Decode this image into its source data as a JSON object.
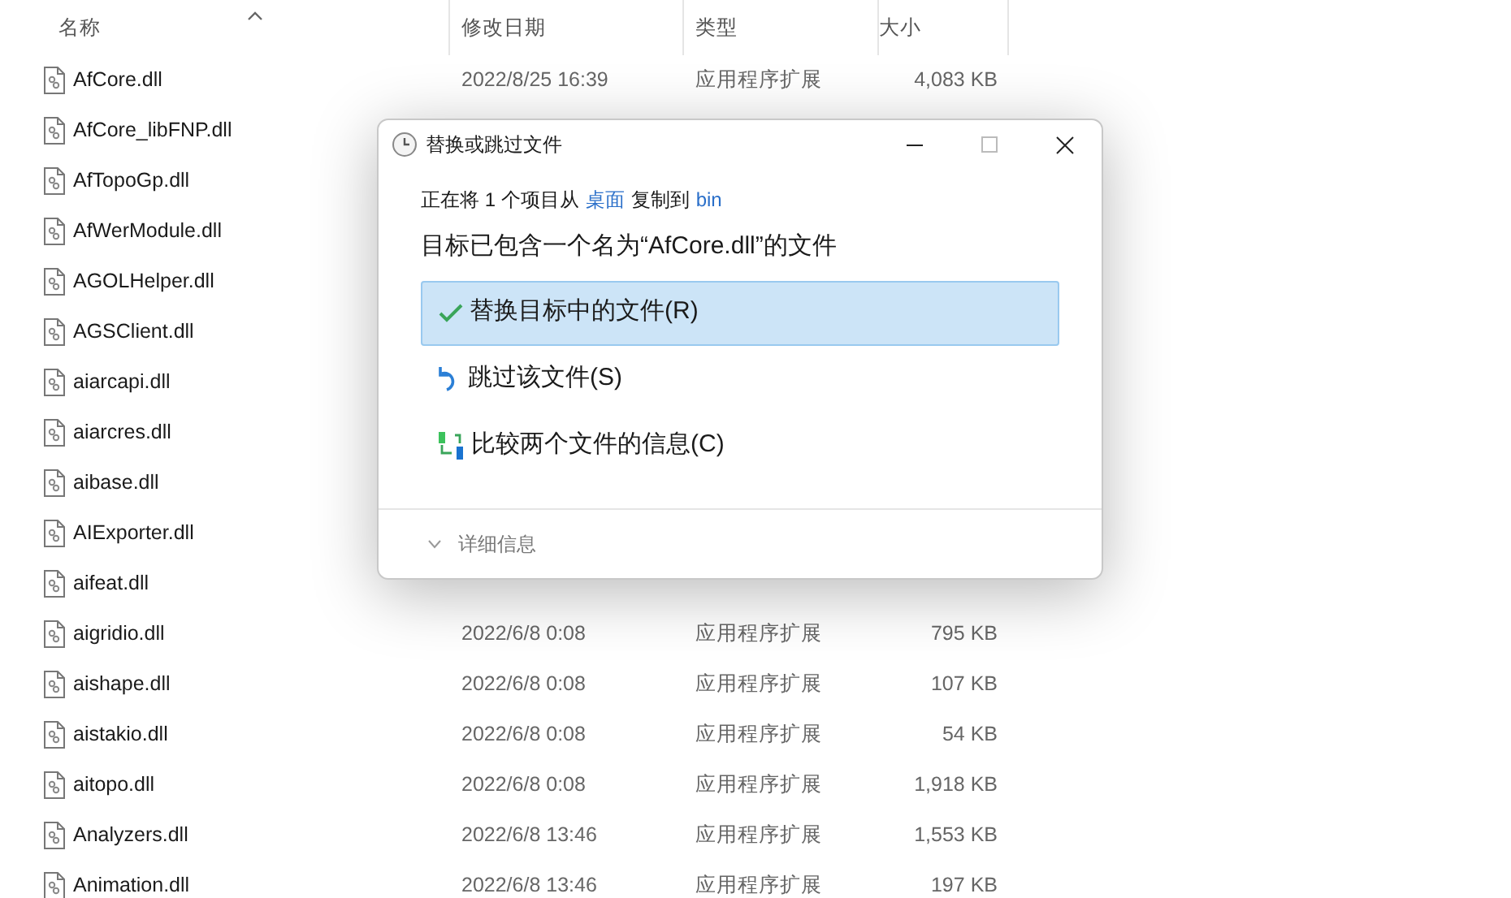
{
  "columns": [
    {
      "label": "名称",
      "sorted": true
    },
    {
      "label": "修改日期",
      "sorted": false
    },
    {
      "label": "类型",
      "sorted": false
    },
    {
      "label": "大小",
      "sorted": false
    }
  ],
  "rows": [
    {
      "name": "AfCore.dll",
      "date": "2022/8/25 16:39",
      "type": "应用程序扩展",
      "size": "4,083 KB"
    },
    {
      "name": "AfCore_libFNP.dll"
    },
    {
      "name": "AfTopoGp.dll"
    },
    {
      "name": "AfWerModule.dll"
    },
    {
      "name": "AGOLHelper.dll"
    },
    {
      "name": "AGSClient.dll"
    },
    {
      "name": "aiarcapi.dll"
    },
    {
      "name": "aiarcres.dll"
    },
    {
      "name": "aibase.dll"
    },
    {
      "name": "AIExporter.dll"
    },
    {
      "name": "aifeat.dll"
    },
    {
      "name": "aigridio.dll",
      "date": "2022/6/8 0:08",
      "type": "应用程序扩展",
      "size": "795 KB"
    },
    {
      "name": "aishape.dll",
      "date": "2022/6/8 0:08",
      "type": "应用程序扩展",
      "size": "107 KB"
    },
    {
      "name": "aistakio.dll",
      "date": "2022/6/8 0:08",
      "type": "应用程序扩展",
      "size": "54 KB"
    },
    {
      "name": "aitopo.dll",
      "date": "2022/6/8 0:08",
      "type": "应用程序扩展",
      "size": "1,918 KB"
    },
    {
      "name": "Analyzers.dll",
      "date": "2022/6/8 13:46",
      "type": "应用程序扩展",
      "size": "1,553 KB"
    },
    {
      "name": "Animation.dll",
      "date": "2022/6/8 13:46",
      "type": "应用程序扩展",
      "size": "197 KB"
    }
  ],
  "dialog": {
    "title": "替换或跳过文件",
    "status": [
      {
        "kind": "text",
        "text": "正在将 1 个项目从"
      },
      {
        "kind": "link",
        "text": "桌面"
      },
      {
        "kind": "text",
        "text": "复制到"
      },
      {
        "kind": "link",
        "text": "bin"
      }
    ],
    "heading": "目标已包含一个名为“AfCore.dll”的文件",
    "options": [
      {
        "kind": "replace",
        "label": "替换目标中的文件(R)",
        "selected": true
      },
      {
        "kind": "skip",
        "label": "跳过该文件(S)",
        "selected": false
      },
      {
        "kind": "compare",
        "label": "比较两个文件的信息(C)",
        "selected": false
      }
    ],
    "details": {
      "label": "详细信息",
      "expanded": false
    }
  }
}
